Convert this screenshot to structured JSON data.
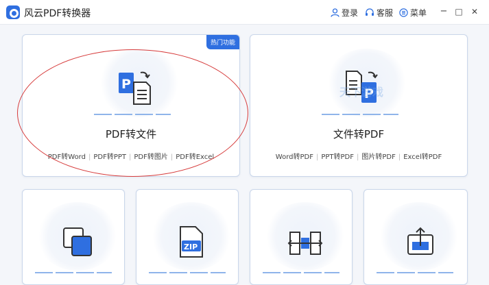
{
  "app": {
    "title": "风云PDF转换器"
  },
  "titlebar": {
    "login": "登录",
    "service": "客服",
    "menu": "菜单",
    "minimize": "−",
    "maximize": "□",
    "close": "✕"
  },
  "cards": {
    "pdf_to_file": {
      "badge": "热门功能",
      "title": "PDF转文件",
      "links": [
        "PDF转Word",
        "PDF转PPT",
        "PDF转图片",
        "PDF转Excel"
      ]
    },
    "file_to_pdf": {
      "title": "文件转PDF",
      "links": [
        "Word转PDF",
        "PPT转PDF",
        "图片转PDF",
        "Excel转PDF"
      ],
      "watermark": "天下游戏"
    }
  },
  "colors": {
    "accent": "#2f6fe0",
    "annotation": "#d63a3a",
    "card_border": "#c9d6ea"
  }
}
